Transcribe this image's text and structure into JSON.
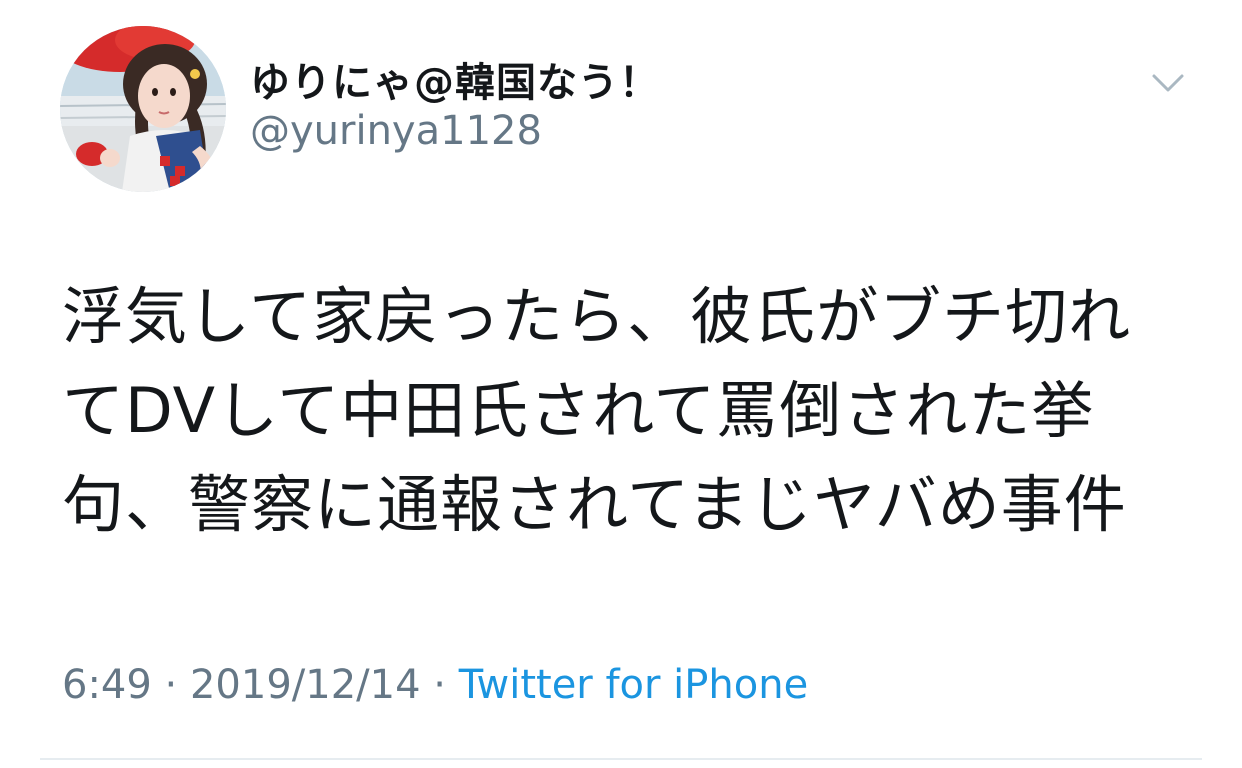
{
  "tweet": {
    "display_name": "ゆりにゃ@韓国なう！",
    "handle": "@yurinya1128",
    "text_lines": [
      "浮気して家戻ったら、彼氏がブチ切れ",
      "てDVして中田氏されて罵倒された挙",
      "句、警察に通報されてまじヤバめ事件"
    ],
    "time": "6:49",
    "separator": "·",
    "date": "2019/12/14",
    "source": "Twitter for iPhone"
  },
  "icons": {
    "menu": "chevron-down-icon",
    "avatar": "profile-photo"
  },
  "colors": {
    "text": "#14171a",
    "secondary": "#657786",
    "link": "#1b95e0",
    "divider": "#e6ecf0",
    "chevron": "#aab8c2"
  }
}
